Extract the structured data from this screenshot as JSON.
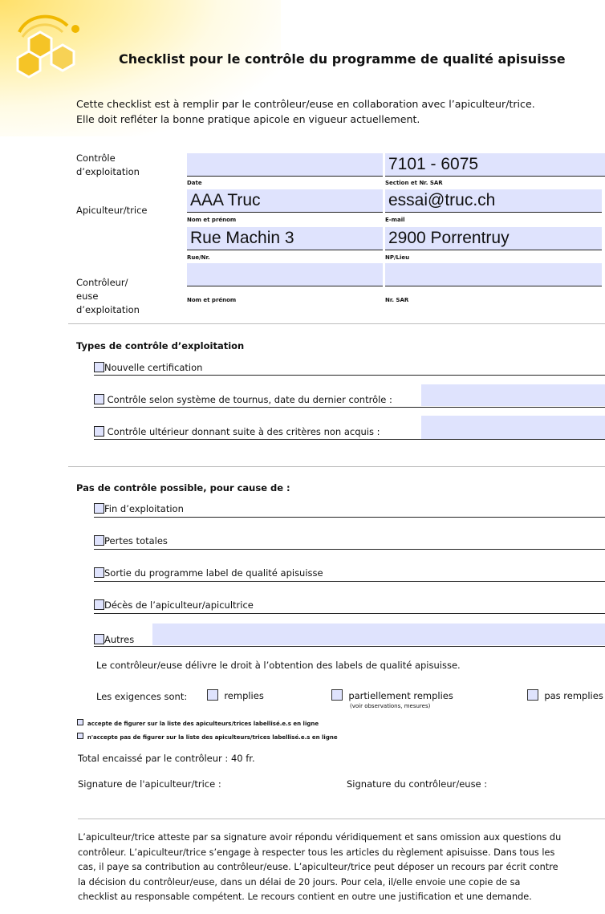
{
  "title": "Checklist pour le contrôle du programme de qualité apisuisse",
  "intro": [
    "Cette checklist est à remplir par le contrôleur/euse en collaboration avec l’apiculteur/trice.",
    "Elle doit refléter la bonne pratique apicole en vigueur actuellement."
  ],
  "exploitation": {
    "label_line1": "Contrôle",
    "label_line2": "d’exploitation",
    "date_value": "",
    "date_caption": "Date",
    "section_value": "7101 - 6075",
    "section_caption": "Section et Nr. SAR"
  },
  "apiculteur": {
    "label": "Apiculteur/trice",
    "name_value": "AAA Truc",
    "name_caption": "Nom et prénom",
    "email_value": "essai@truc.ch",
    "email_caption": "E-mail",
    "street_value": "Rue Machin 3",
    "street_caption": "Rue/Nr.",
    "city_value": "2900 Porrentruy",
    "city_caption": "NP/Lieu"
  },
  "controleur": {
    "label_line1": "Contrôleur/",
    "label_line2": "euse",
    "label_line3": "d’exploitation",
    "name_value": "",
    "name_caption": "Nom et prénom",
    "sar_value": "",
    "sar_caption": "Nr. SAR"
  },
  "types": {
    "heading": "Types de contrôle d’exploitation",
    "items": [
      "Nouvelle certification",
      "Contrôle selon système de tournus, date du dernier contrôle :",
      "Contrôle ultérieur donnant suite à des critères non acquis :"
    ]
  },
  "pas_controle": {
    "heading": "Pas de contrôle possible, pour cause de :",
    "items": [
      "Fin d’exploitation",
      "Pertes totales",
      "Sortie du programme label de qualité apisuisse",
      "Décès de l’apiculteur/apicultrice",
      "Autres"
    ]
  },
  "droit_text": "Le contrôleur/euse délivre le droit à l’obtention des labels de qualité apisuisse.",
  "exigences": {
    "label": "Les exigences sont:",
    "opt1": "remplies",
    "opt2": "partiellement remplies",
    "opt2_note": "(voir observations, mesures)",
    "opt3": "pas remplies"
  },
  "liste": {
    "accept": "accepte de figurer sur la liste des apiculteurs/trices labellisé.e.s en ligne",
    "refuse": "n'accepte pas de figurer sur la liste des apiculteurs/trices labellisé.e.s en ligne"
  },
  "total": "Total encaissé par le contrôleur : 40 fr.",
  "sig_apiculteur": "Signature de l'apiculteur/trice :",
  "sig_controleur": "Signature du contrôleur/euse :",
  "final_paragraph": [
    "L’apiculteur/trice atteste par sa signature avoir répondu véridiquement et sans omission aux questions du",
    "contrôleur. L’apiculteur/trice s’engage à respecter tous les articles du règlement apisuisse. Dans tous les",
    "cas, il paye sa contribution au contrôleur/euse. L’apiculteur/trice peut déposer un recours par écrit contre",
    "la décision du contrôleur/euse, dans un délai de 20 jours. Pour cela, il/elle envoie une copie de sa",
    "checklist au responsable compétent. Le recours contient en outre une justification et une demande."
  ],
  "colors": {
    "field": "#dfe3fd",
    "logo": "#f3c31b"
  }
}
